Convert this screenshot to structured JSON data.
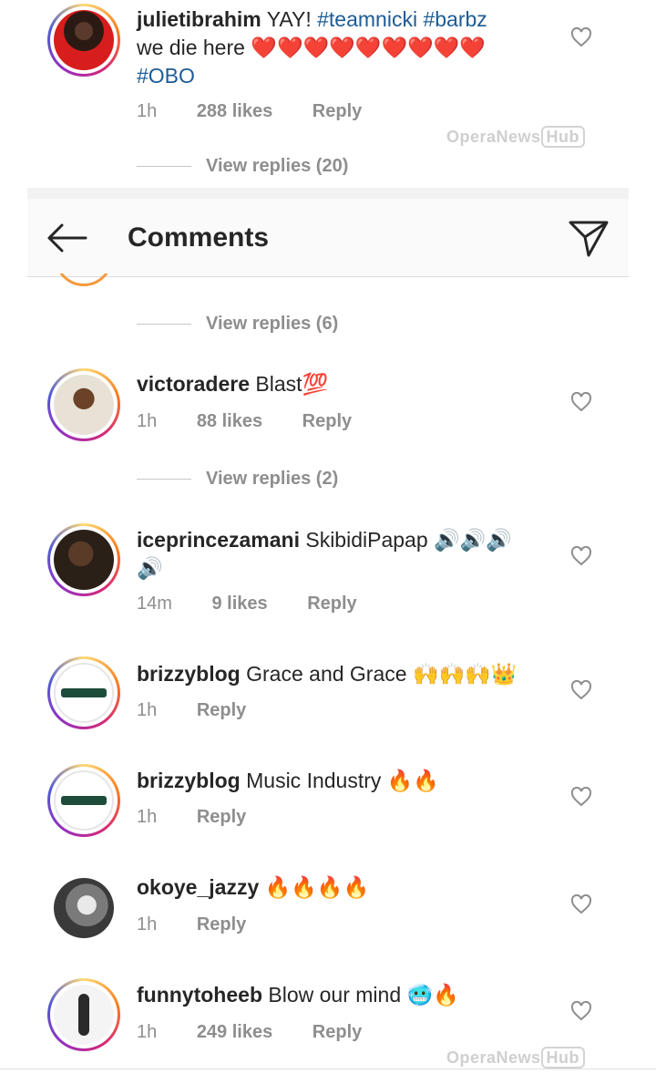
{
  "colors": {
    "hashtag": "#1d5c96",
    "meta": "#8e8e8e",
    "text": "#262626"
  },
  "top_comment": {
    "username": "julietibrahim",
    "text_plain": "YAY! ",
    "tags": [
      "#teamnicki",
      "#barbz"
    ],
    "text_line2": "we die here",
    "emoji": "❤️❤️❤️❤️❤️❤️❤️❤️❤️",
    "tag3": "#OBO",
    "time": "1h",
    "likes": "288 likes",
    "reply": "Reply",
    "view_replies": "View replies (20)"
  },
  "header": {
    "title": "Comments",
    "back_icon": "arrow-left-icon",
    "share_icon": "paper-plane-icon"
  },
  "watermark": {
    "text": "OperaNews",
    "box": "Hub"
  },
  "comments": [
    {
      "view_replies": "View replies (6)"
    },
    {
      "username": "victoradere",
      "text": "Blast",
      "emoji": "💯",
      "time": "1h",
      "likes": "88 likes",
      "reply": "Reply",
      "view_replies": "View replies (2)"
    },
    {
      "username": "iceprincezamani",
      "text": "SkibidiPapap",
      "emoji": "🔊🔊🔊",
      "emoji2": "🔊",
      "time": "14m",
      "likes": "9 likes",
      "reply": "Reply"
    },
    {
      "username": "brizzyblog",
      "text": "Grace and Grace",
      "emoji": "🙌🙌🙌👑",
      "time": "1h",
      "reply": "Reply"
    },
    {
      "username": "brizzyblog",
      "text": "Music Industry",
      "emoji": "🔥🔥",
      "time": "1h",
      "reply": "Reply"
    },
    {
      "username": "okoye_jazzy",
      "text": "",
      "emoji": "🔥🔥🔥🔥",
      "time": "1h",
      "reply": "Reply"
    },
    {
      "username": "funnytoheeb",
      "text": "Blow our mind",
      "emoji": "🥶🔥",
      "time": "1h",
      "likes": "249 likes",
      "reply": "Reply"
    }
  ]
}
